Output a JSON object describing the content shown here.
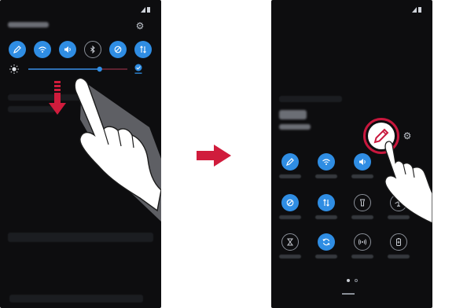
{
  "left_screen": {
    "status_icons": [
      "signal-icon",
      "battery-icon"
    ],
    "toggles": [
      {
        "icon": "edit-pencil-icon",
        "active": true
      },
      {
        "icon": "wifi-icon",
        "active": true
      },
      {
        "icon": "sound-icon",
        "active": true
      },
      {
        "icon": "bluetooth-icon",
        "active": false
      },
      {
        "icon": "rotation-icon",
        "active": true
      },
      {
        "icon": "data-icon",
        "active": true
      }
    ],
    "brightness_level": 0.72
  },
  "right_screen": {
    "status_icons": [
      "signal-icon",
      "battery-icon"
    ],
    "grid_rows": [
      [
        {
          "icon": "edit-pencil-icon",
          "active": true
        },
        {
          "icon": "wifi-icon",
          "active": true
        },
        {
          "icon": "sound-icon",
          "active": true
        }
      ],
      [
        {
          "icon": "rotation-icon",
          "active": true
        },
        {
          "icon": "data-icon",
          "active": true
        },
        {
          "icon": "flashlight-icon",
          "active": false
        },
        {
          "icon": "airplane-icon",
          "active": false
        }
      ],
      [
        {
          "icon": "hourglass-icon",
          "active": false
        },
        {
          "icon": "sync-icon",
          "active": true
        },
        {
          "icon": "hotspot-icon",
          "active": false
        },
        {
          "icon": "battery-saver-icon",
          "active": false
        }
      ]
    ],
    "page_indicator": {
      "current": 1,
      "total": 2
    }
  },
  "colors": {
    "screen_bg": "#0d0d0f",
    "toggle_on": "#2f8de3",
    "highlight_ring": "#c8173d",
    "arrow_down": "#d01c3c",
    "arrow_middle": "#d01c3c"
  }
}
